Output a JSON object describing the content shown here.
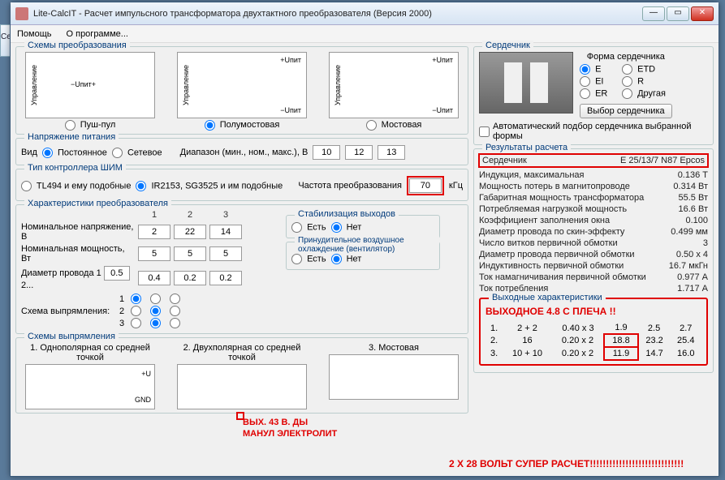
{
  "window": {
    "title": "Lite-CalcIT - Расчет импульсного трансформатора двухтактного преобразователя (Версия 2000)"
  },
  "menu": {
    "help": "Помощь",
    "about": "О программе..."
  },
  "side_label": "Се",
  "schemes": {
    "legend": "Схемы преобразования",
    "vlabel": "Управление",
    "push_pull": "Пуш-пул",
    "half_bridge": "Полумостовая",
    "bridge": "Мостовая",
    "u_sup_plus": "+Uпит",
    "u_sup_minus": "−Uпит",
    "u_sup_pm": "−Uпит+"
  },
  "power": {
    "legend": "Напряжение питания",
    "type_label": "Вид",
    "dc": "Постоянное",
    "ac": "Сетевое",
    "range_label": "Диапазон (мин., ном., макс.), В",
    "min": "10",
    "nom": "12",
    "max": "13"
  },
  "pwm": {
    "legend": "Тип контроллера ШИМ",
    "tl494": "TL494 и ему подобные",
    "ir2153": "IR2153, SG3525 и им подобные",
    "freq_label": "Частота преобразования",
    "freq_value": "70",
    "freq_unit": "кГц"
  },
  "conv": {
    "legend": "Характеристики преобразователя",
    "col1": "1",
    "col2": "2",
    "col3": "3",
    "nom_voltage": "Номинальное напряжение, В",
    "nom_power": "Номинальная мощность, Вт",
    "wire_diam": "Диаметр провода 1",
    "wire_sep": "2...",
    "v1": "2",
    "v2": "22",
    "v3": "14",
    "p1": "5",
    "p2": "5",
    "p3": "5",
    "d1": "0.5",
    "d2": "0.4",
    "d3": "0.2",
    "d4": "0.2",
    "rect_scheme": "Схема выпрямления:",
    "stab_legend": "Стабилизация выходов",
    "yes": "Есть",
    "no": "Нет",
    "fan_legend": "Принудительное воздушное охлаждение (вентилятор)"
  },
  "rect": {
    "legend": "Схемы выпрямления",
    "s1": "1. Однополярная со средней точкой",
    "s2": "2. Двухполярная со средней точкой",
    "s3": "3. Мостовая",
    "plusU": "+U",
    "gnd": "GND"
  },
  "core": {
    "legend": "Сердечник",
    "form_legend": "Форма сердечника",
    "E": "E",
    "ETD": "ETD",
    "EI": "EI",
    "R": "R",
    "ER": "ER",
    "Other": "Другая",
    "pick_btn": "Выбор сердечника",
    "autofit": "Автоматический подбор сердечника выбранной формы"
  },
  "results": {
    "legend": "Результаты расчета",
    "core_label": "Сердечник",
    "core_value": "E 25/13/7 N87 Epcos",
    "r1_l": "Индукция, максимальная",
    "r1_v": "0.136 Т",
    "r2_l": "Мощность потерь в магнитопроводе",
    "r2_v": "0.314 Вт",
    "r3_l": "Габаритная мощность трансформатора",
    "r3_v": "55.5 Вт",
    "r4_l": "Потребляемая нагрузкой мощность",
    "r4_v": "16.6 Вт",
    "r5_l": "Коэффициент заполнения окна",
    "r5_v": "0.100",
    "r6_l": "Диаметр провода по скин-эффекту",
    "r6_v": "0.499 мм",
    "r7_l": "Число витков первичной обмотки",
    "r7_v": "3",
    "r8_l": "Диаметр провода первичной обмотки",
    "r8_v": "0.50 x 4",
    "r9_l": "Индуктивность первичной обмотки",
    "r9_v": "16.7 мкГн",
    "r10_l": "Ток намагничивания первичной обмотки",
    "r10_v": "0.977 А",
    "r11_l": "Ток потребления",
    "r11_v": "1.717 А",
    "out_legend": "Выходные характеристики",
    "rows": [
      {
        "n": "1.",
        "a": "2 + 2",
        "b": "0.40 x 3",
        "c": "1.9",
        "d": "2.5",
        "e": "2.7"
      },
      {
        "n": "2.",
        "a": "16",
        "b": "0.20 x 2",
        "c": "18.8",
        "d": "23.2",
        "e": "25.4"
      },
      {
        "n": "3.",
        "a": "10 + 10",
        "b": "0.20 x 2",
        "c": "11.9",
        "d": "14.7",
        "e": "16.0"
      }
    ]
  },
  "anno": {
    "out48": "ВЫХОДНОЕ 4.8 С ПЛЕЧА !!",
    "out43a": "ВЫХ. 43 В. ДЫ",
    "out43b": "МАНУЛ ЭЛЕКТРОЛИТ",
    "final": "2 Х 28 ВОЛЬТ  СУПЕР РАСЧЕТ!!!!!!!!!!!!!!!!!!!!!!!!!!!!!"
  }
}
